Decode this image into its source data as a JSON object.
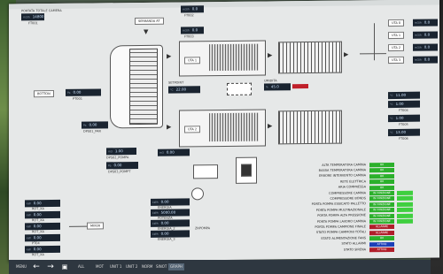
{
  "header": {
    "title": "PORTATA TOTALE CAMERA",
    "title_value": "14800",
    "title_unit": "m3/h",
    "title_sub": "FT001"
  },
  "top_tags": {
    "serranda": "SERRANDA AT",
    "t1": "FT002",
    "t2": "FT003",
    "t3": "FT004"
  },
  "upper": {
    "unit_label": "UTA 1",
    "setpoint_lbl": "SETPOINT",
    "value1": "22.00",
    "value1_unit": "°C",
    "value2": "21.50",
    "value2_unit": "°C",
    "t_label": "TT005",
    "humid_lbl": "UMIDITA",
    "humid_val": "45.0",
    "humid_unit": "%"
  },
  "lower": {
    "unit_label": "UTA 2"
  },
  "left": {
    "button": "BOTTON",
    "val1": "0.00",
    "val1_unit": "Pa",
    "tag1": "PT001",
    "val2": "0.00",
    "val2_unit": "Pa",
    "tag2": "DPS01_PAR",
    "val3": "1.00",
    "val3_unit": "m3",
    "tag3": "DPS02_POMPA",
    "val4": "0.00",
    "val4_unit": "Pa",
    "tag4": "DPS03_POMPT"
  },
  "right_top": {
    "lbl1": "UTA 0",
    "lbl2": "UTA 1",
    "lbl3": "UTA 2",
    "lbl4": "UTA 3",
    "v1": "0.0",
    "v2": "0.0",
    "v3": "0.0",
    "v4": "0.0",
    "unit": "m3/h"
  },
  "right_mid": {
    "v1": "11.00",
    "v2": "1.00",
    "v3": "1.00",
    "v4": "13.00",
    "unit": "°C",
    "t1": "FT004",
    "t2": "FT005",
    "t3": "FT006"
  },
  "bottom_left": {
    "rows": [
      {
        "u": "kW",
        "v": "0.00",
        "t": "ROT_XA"
      },
      {
        "u": "kW",
        "v": "0.00",
        "t": "ROT_XA"
      },
      {
        "u": "kW",
        "v": "0.00",
        "t": "ROT_XA"
      },
      {
        "u": "kW",
        "v": "0.00",
        "t": "PT04"
      },
      {
        "u": "kW",
        "v": "0.00",
        "t": "ROT_XA"
      }
    ],
    "mixer": "MIXER"
  },
  "bottom_mid": {
    "rows": [
      {
        "u": "kWh",
        "v": "0.00",
        "t": "ENERGIA"
      },
      {
        "u": "kWh",
        "v": "5000.00",
        "t": "POTENZA"
      },
      {
        "u": "kWh",
        "v": "0.00",
        "t": "ENERGIA_2"
      },
      {
        "u": "kWh",
        "v": "0.00",
        "t": "ENERGIA_3"
      }
    ],
    "label": "ZRPOMPA"
  },
  "status": [
    {
      "label": "ALTA TEMPERATURA CAMINA",
      "state": "OK",
      "color": "#2bb02b"
    },
    {
      "label": "BASSA TEMPERATURA CAMINA",
      "state": "OK",
      "color": "#2bb02b"
    },
    {
      "label": "ERRORE INTERVENTO CAMINA",
      "state": "OK",
      "color": "#2bb02b"
    },
    {
      "label": "RETE ELETTRICA",
      "state": "OK",
      "color": "#2bb02b"
    },
    {
      "label": "ARIA COMPRESSA",
      "state": "OK",
      "color": "#2bb02b"
    },
    {
      "label": "COMPRESSORE CAMINA",
      "state": "IN FUNZIONE",
      "color": "#2bb02b"
    },
    {
      "label": "COMPRESSORE BONDS",
      "state": "IN FUNZIONE",
      "color": "#2bb02b"
    },
    {
      "label": "PORTA POMPA ESSICATO PALLETTO",
      "state": "IN FUNZIONE",
      "color": "#2bb02b"
    },
    {
      "label": "PORTA POMPA MULTINAZIONALE",
      "state": "IN FUNZIONE",
      "color": "#2bb02b"
    },
    {
      "label": "PORTA POMPA ALTA PRESSIONE",
      "state": "IN FUNZIONE",
      "color": "#2bb02b"
    },
    {
      "label": "PORTA POMPA LAVORO CAMINA",
      "state": "IN FUNZIONE",
      "color": "#2bb02b"
    },
    {
      "label": "PORTA POMPA CAMPIONE FINALE",
      "state": "ALLARME",
      "color": "#b01e2a"
    },
    {
      "label": "STATO POMPA CAMPIONI TOTALI",
      "state": "ALLARME",
      "color": "#b01e2a"
    },
    {
      "label": "STATO ALIMENTAZIONE FANS",
      "state": "OK",
      "color": "#2bb02b"
    },
    {
      "label": "STATO ALLARMI",
      "state": "ATTIVO",
      "color": "#1c3fb8"
    },
    {
      "label": "STATO SIRENA",
      "state": "ATTIVO",
      "color": "#b01e2a"
    }
  ],
  "taskbar": {
    "menu": "MENU",
    "all": "ALL",
    "b1": "MOT",
    "b2": "UNIT 1",
    "b3": "UNIT 2",
    "b4": "NORM",
    "b5": "SINOT",
    "b6": "GRAPH"
  },
  "colors": {
    "ok": "#2bb02b",
    "alarm": "#b01e2a",
    "info": "#1c3fb8",
    "panel": "#1a2430"
  }
}
